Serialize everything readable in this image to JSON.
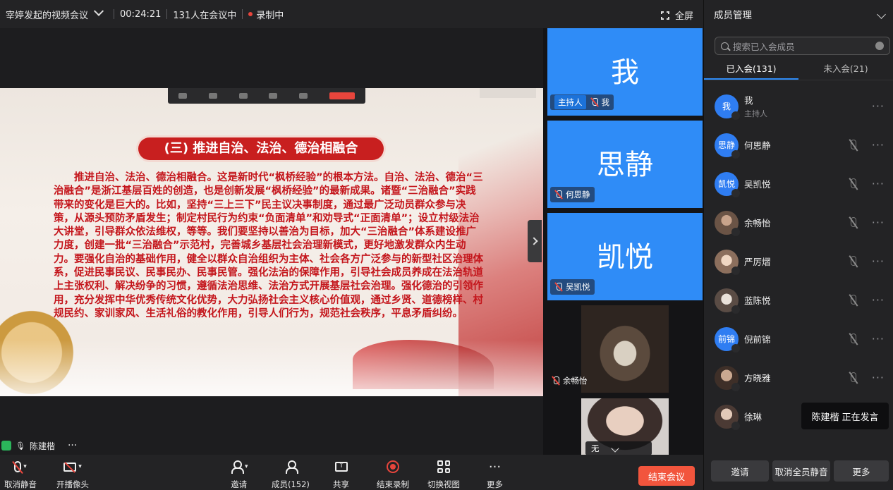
{
  "topbar": {
    "meeting_title": "宰婷发起的视频会议",
    "duration": "00:24:21",
    "participants_text": "131人在会议中",
    "recording_text": "录制中",
    "fullscreen_label": "全屏"
  },
  "slide": {
    "title": "(三) 推进自治、法治、德治相融合",
    "body": "推进自治、法治、德治相融合。这是新时代“枫桥经验”的根本方法。自治、法治、德治“三治融合”是浙江基层百姓的创造，也是创新发展“枫桥经验”的最新成果。诸暨“三治融合”实践带来的变化是巨大的。比如，坚持“三上三下”民主议决事制度，通过最广泛动员群众参与决策，从源头预防矛盾发生；制定村民行为约束“负面清单”和劝导式“正面清单”；设立村级法治大讲堂，引导群众依法维权，等等。我们要坚持以善治为目标，加大“三治融合”体系建设推广力度，创建一批“三治融合”示范村，完善城乡基层社会治理新模式，更好地激发群众内生动力。要强化自治的基础作用，健全以群众自治组织为主体、社会各方广泛参与的新型社区治理体系，促进民事民议、民事民办、民事民管。强化法治的保障作用，引导社会成员养成在法治轨道上主张权利、解决纷争的习惯，遵循法治思维、法治方式开展基层社会治理。强化德治的引领作用，充分发挥中华优秀传统文化优势，大力弘扬社会主义核心价值观，通过乡贤、道德榜样、村规民约、家训家风、生活礼俗的教化作用，引导人们行为，规范社会秩序，平息矛盾纠纷。"
  },
  "stage": {
    "speaker_name": "陈建楷",
    "more": "···"
  },
  "videos": {
    "tiles": [
      {
        "big": "我",
        "badge": "主持人",
        "name": "我"
      },
      {
        "big": "思静",
        "name": "何思静"
      },
      {
        "big": "凯悦",
        "name": "吴凯悦"
      }
    ],
    "cam1_name": "余畅怡",
    "cam2_overlay": "无"
  },
  "panel": {
    "title": "成员管理",
    "search_placeholder": "搜索已入会成员",
    "tab_joined": "已入会(131)",
    "tab_not_joined": "未入会(21)",
    "members": [
      {
        "avatar": "我",
        "name": "我",
        "sub": "主持人",
        "photo": false
      },
      {
        "avatar": "思静",
        "name": "何思静",
        "photo": false
      },
      {
        "avatar": "凯悦",
        "name": "吴凯悦",
        "photo": false
      },
      {
        "avatar": "",
        "name": "余畅怡",
        "photo": true
      },
      {
        "avatar": "",
        "name": "严厉熠",
        "photo": true
      },
      {
        "avatar": "",
        "name": "蓝陈悦",
        "photo": true
      },
      {
        "avatar": "前锦",
        "name": "倪前锦",
        "photo": false
      },
      {
        "avatar": "",
        "name": "方晓雅",
        "photo": true
      },
      {
        "avatar": "",
        "name": "徐琳",
        "photo": true
      }
    ],
    "more": "···",
    "speaking_name": "陈建楷",
    "speaking_text": "正在发言",
    "invite": "邀请",
    "unmute_all": "取消全员静音",
    "more_btn": "更多"
  },
  "toolbar": {
    "unmute": "取消静音",
    "start_video": "开播像头",
    "invite": "邀请",
    "members": "成员(152)",
    "share": "共享",
    "end_record": "结束录制",
    "switch_view": "切换视图",
    "more": "更多",
    "end_meeting": "结束会议",
    "more_dots": "···"
  },
  "colors": {
    "accent": "#2f8cf7",
    "danger": "#f2553d",
    "slide_text": "#c4161c"
  }
}
